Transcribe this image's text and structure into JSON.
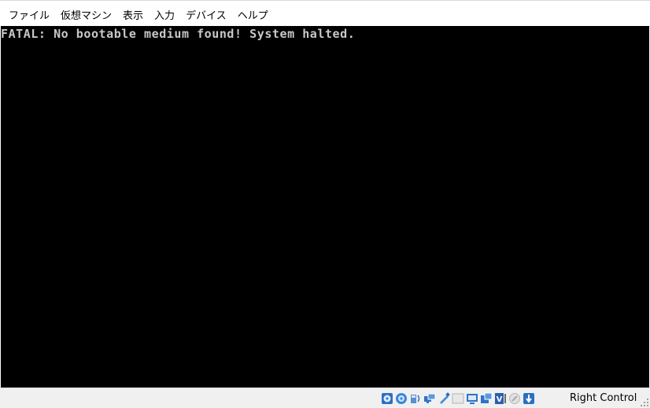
{
  "menubar": {
    "items": [
      "ファイル",
      "仮想マシン",
      "表示",
      "入力",
      "デバイス",
      "ヘルプ"
    ]
  },
  "screen": {
    "console_text": "FATAL: No bootable medium found! System halted."
  },
  "statusbar": {
    "icons": [
      "hard-disk-icon",
      "optical-drive-icon",
      "audio-icon",
      "network-icon",
      "usb-icon",
      "shared-folders-icon",
      "display-icon",
      "video-capture-icon",
      "cpu-icon",
      "mouse-integration-icon",
      "host-key-arrow-icon"
    ],
    "host_key_label": "Right Control"
  }
}
